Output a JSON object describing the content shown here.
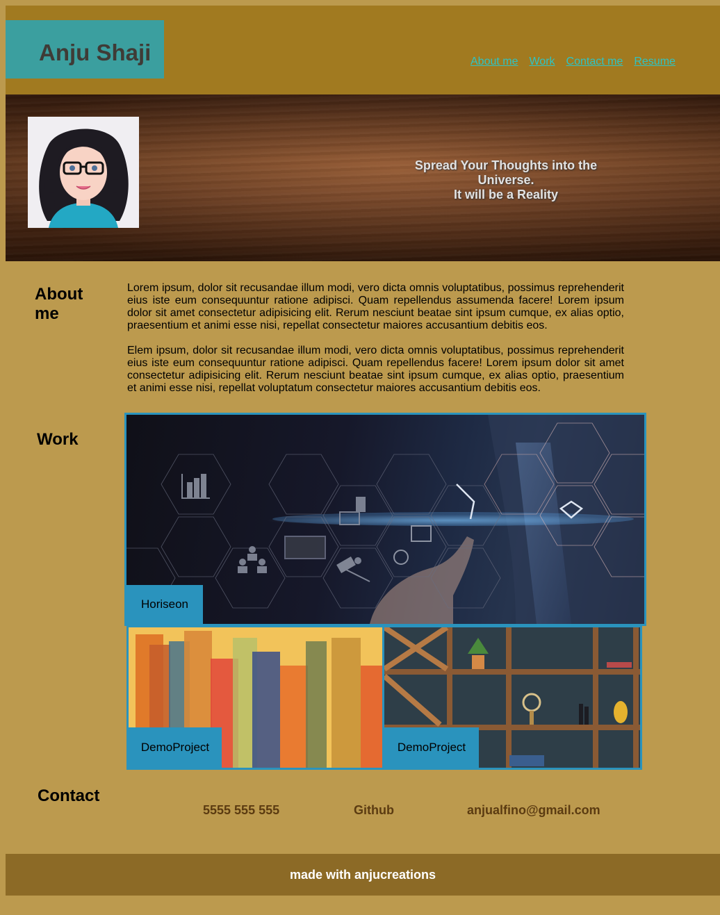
{
  "header": {
    "site_title": "Anju Shaji",
    "nav": [
      {
        "label": "About me"
      },
      {
        "label": "Work"
      },
      {
        "label": "Contact me"
      },
      {
        "label": "Resume"
      }
    ]
  },
  "hero": {
    "tagline_line1": "Spread Your Thoughts into the Universe.",
    "tagline_line2": "It will be a Reality"
  },
  "about": {
    "title": "About me",
    "paragraphs": [
      "Lorem ipsum, dolor sit recusandae illum modi, vero dicta omnis voluptatibus, possimus reprehenderit eius iste eum consequuntur ratione adipisci. Quam repellendus assumenda facere! Lorem ipsum dolor sit amet consectetur adipisicing elit. Rerum nesciunt beatae sint ipsum cumque, ex alias optio, praesentium et animi esse nisi, repellat consectetur maiores accusantium debitis eos.",
      "Elem ipsum, dolor sit recusandae illum modi, vero dicta omnis voluptatibus, possimus reprehenderit eius iste eum consequuntur ratione adipisci. Quam repellendus facere! Lorem ipsum dolor sit amet consectetur adipisicing elit. Rerum nesciunt beatae sint ipsum cumque, ex alias optio, praesentium et animi esse nisi, repellat voluptatum consectetur maiores accusantium debitis eos."
    ]
  },
  "work": {
    "title": "Work",
    "projects": [
      {
        "label": "Horiseon"
      },
      {
        "label": "DemoProject"
      },
      {
        "label": "DemoProject"
      }
    ]
  },
  "contact": {
    "title": "Contact",
    "phone": "5555 555 555",
    "github": "Github",
    "email": "anjualfino@gmail.com"
  },
  "footer": {
    "text": "made with anjucreations"
  },
  "colors": {
    "page_bg": "#bc9a4e",
    "header_bg": "#a17a20",
    "logo_bg": "#3b9f9f",
    "nav_link": "#2ec4c4",
    "accent_blue": "#2a93bd",
    "contact_text": "#5b3b11",
    "footer_bg": "#8c6a26"
  }
}
